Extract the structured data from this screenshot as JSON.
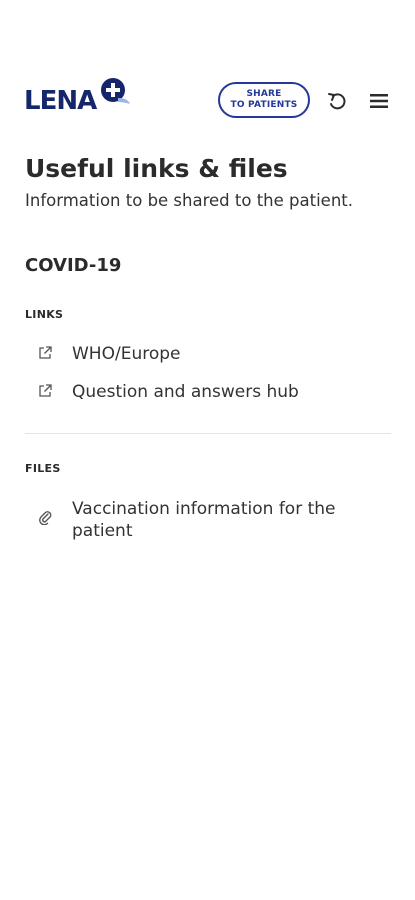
{
  "header": {
    "logo_text": "LENA",
    "share_label_line1": "SHARE",
    "share_label_line2": "TO PATIENTS"
  },
  "page": {
    "title": "Useful links & files",
    "subtitle": "Information to be shared to the patient."
  },
  "section": {
    "title": "COVID-19",
    "links_label": "LINKS",
    "links": [
      {
        "label": "WHO/Europe",
        "icon": "external-link-icon"
      },
      {
        "label": "Question and answers hub",
        "icon": "external-link-icon"
      }
    ],
    "files_label": "FILES",
    "files": [
      {
        "label": "Vaccination information for the patient",
        "icon": "paperclip-icon"
      }
    ]
  },
  "colors": {
    "brand_navy": "#16266b",
    "brand_blue": "#23389a",
    "text": "#2b2b2b"
  }
}
